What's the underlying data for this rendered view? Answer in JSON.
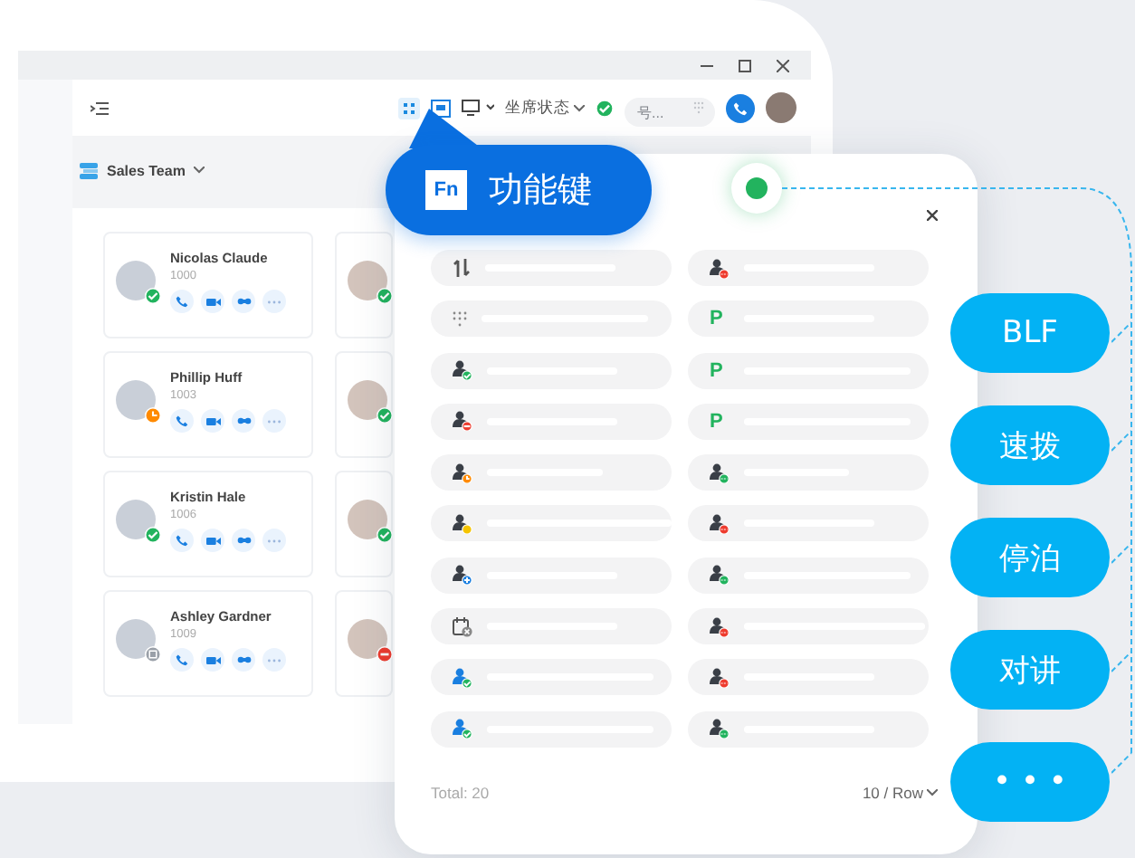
{
  "toolbar": {
    "agent_status_label": "坐席状态",
    "agent_status": {
      "kind": "available"
    },
    "search": {
      "placeholder": "号..."
    }
  },
  "group": {
    "name": "Sales Team"
  },
  "contacts": [
    {
      "name": "Nicolas Claude",
      "ext": "1000",
      "kind": "available"
    },
    {
      "name": "Phillip Huff",
      "ext": "1003",
      "kind": "away"
    },
    {
      "name": "Kristin Hale",
      "ext": "1006",
      "kind": "available"
    },
    {
      "name": "Ashley Gardner",
      "ext": "1009",
      "kind": "offline"
    }
  ],
  "contacts_column_2": [
    {
      "kind": "available"
    },
    {
      "kind": "available"
    },
    {
      "kind": "available"
    },
    {
      "kind": "dnd"
    }
  ],
  "callout": {
    "icon_text": "Fn",
    "label": "功能键"
  },
  "fn_panel": {
    "keys": [
      {
        "kind": "transfer"
      },
      {
        "kind": "person-oncall"
      },
      {
        "kind": "dialpad"
      },
      {
        "kind": "park",
        "icon_text": "P"
      },
      {
        "kind": "person-available"
      },
      {
        "kind": "park",
        "icon_text": "P"
      },
      {
        "kind": "person-dnd"
      },
      {
        "kind": "park",
        "icon_text": "P"
      },
      {
        "kind": "person-away"
      },
      {
        "kind": "person-idle"
      },
      {
        "kind": "person-busy"
      },
      {
        "kind": "person-oncall"
      },
      {
        "kind": "person-add"
      },
      {
        "kind": "person-idle"
      },
      {
        "kind": "calendar-off"
      },
      {
        "kind": "person-oncall"
      },
      {
        "kind": "user-available"
      },
      {
        "kind": "person-oncall"
      },
      {
        "kind": "user-available"
      },
      {
        "kind": "person-idle"
      }
    ],
    "total": "Total: 20",
    "page_size": "10 / Row"
  },
  "features": [
    "BLF",
    "速拨",
    "停泊",
    "对讲",
    "• • •"
  ]
}
